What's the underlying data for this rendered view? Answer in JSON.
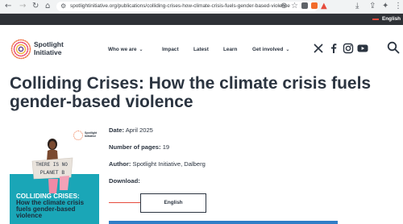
{
  "browser": {
    "url": "spotlightinitiative.org/publications/colliding-crises-how-climate-crisis-fuels-gender-based-violence"
  },
  "langbar": {
    "language": "English"
  },
  "header": {
    "logo_line1": "Spotlight",
    "logo_line2": "Initiative",
    "nav": [
      "Who we are",
      "Impact",
      "Latest",
      "Learn",
      "Get involved"
    ],
    "social_icons": [
      "x-icon",
      "facebook-icon",
      "instagram-icon",
      "youtube-icon"
    ]
  },
  "page": {
    "title": "Colliding Crises: How the climate crisis fuels gender-based violence"
  },
  "cover": {
    "logo_line1": "Spotlight",
    "logo_line2": "Initiative",
    "sign_line1": "THERE IS NO",
    "sign_line2": "PLANET B",
    "title_line1": "COLLIDING CRISES:",
    "title_line2": "How the climate crisis",
    "title_line3": "fuels gender-based",
    "title_line4": "violence"
  },
  "details": {
    "date_label": "Date:",
    "date_value": "April 2025",
    "pages_label": "Number of pages:",
    "pages_value": "19",
    "author_label": "Author:",
    "author_value": "Spotlight Initiative, Dalberg",
    "download_label": "Download:",
    "download_button": "English"
  },
  "colors": {
    "dark": "#2b3440",
    "accent_red": "#e64b3c",
    "teal": "#1aa6b7",
    "blue": "#2f7ec7"
  }
}
